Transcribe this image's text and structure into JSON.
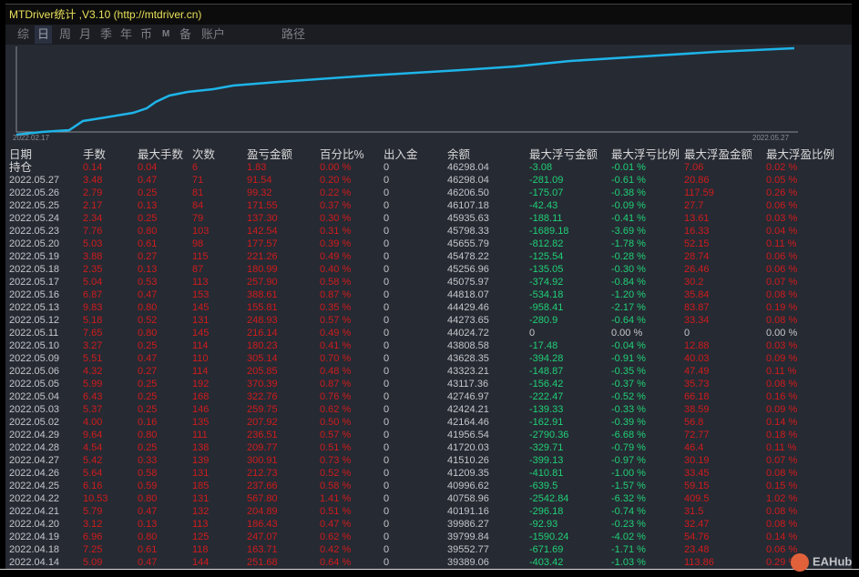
{
  "window": {
    "title": "MTDriver统计 ,V3.10 (http://mtdriver.cn)"
  },
  "toolbar": {
    "items": [
      "综",
      "日",
      "周",
      "月",
      "季",
      "年",
      "币",
      "M",
      "备",
      "账户",
      "路径"
    ],
    "selected": "日"
  },
  "chart": {
    "start_label": "2022.02.17",
    "end_label": "2022.05.27",
    "line_color": "#1eb4e8"
  },
  "table": {
    "headers": [
      "日期",
      "手数",
      "最大手数",
      "次数",
      "盈亏金额",
      "百分比%",
      "出入金",
      "余额",
      "最大浮亏金额",
      "最大浮亏比例",
      "最大浮盈金额",
      "最大浮盈比例"
    ],
    "rows": [
      [
        "持仓",
        "0.14",
        "0.04",
        "6",
        "1.83",
        "0.00 %",
        "0",
        "46298.04",
        "-3.08",
        "-0.01 %",
        "7.06",
        "0.02 %"
      ],
      [
        "2022.05.27",
        "3.48",
        "0.47",
        "71",
        "91.54",
        "0.20 %",
        "0",
        "46298.04",
        "-281.09",
        "-0.61 %",
        "20.86",
        "0.05 %"
      ],
      [
        "2022.05.26",
        "2.79",
        "0.25",
        "81",
        "99.32",
        "0.22 %",
        "0",
        "46206.50",
        "-175.07",
        "-0.38 %",
        "117.59",
        "0.26 %"
      ],
      [
        "2022.05.25",
        "2.17",
        "0.13",
        "84",
        "171.55",
        "0.37 %",
        "0",
        "46107.18",
        "-42.43",
        "-0.09 %",
        "27.7",
        "0.06 %"
      ],
      [
        "2022.05.24",
        "2.34",
        "0.25",
        "79",
        "137.30",
        "0.30 %",
        "0",
        "45935.63",
        "-188.11",
        "-0.41 %",
        "13.61",
        "0.03 %"
      ],
      [
        "2022.05.23",
        "7.76",
        "0.80",
        "103",
        "142.54",
        "0.31 %",
        "0",
        "45798.33",
        "-1689.18",
        "-3.69 %",
        "16.33",
        "0.04 %"
      ],
      [
        "2022.05.20",
        "5.03",
        "0.61",
        "98",
        "177.57",
        "0.39 %",
        "0",
        "45655.79",
        "-812.82",
        "-1.78 %",
        "52.15",
        "0.11 %"
      ],
      [
        "2022.05.19",
        "3.88",
        "0.27",
        "115",
        "221.26",
        "0.49 %",
        "0",
        "45478.22",
        "-125.54",
        "-0.28 %",
        "28.74",
        "0.06 %"
      ],
      [
        "2022.05.18",
        "2.35",
        "0.13",
        "87",
        "180.99",
        "0.40 %",
        "0",
        "45256.96",
        "-135.05",
        "-0.30 %",
        "26.46",
        "0.06 %"
      ],
      [
        "2022.05.17",
        "5.04",
        "0.53",
        "113",
        "257.90",
        "0.58 %",
        "0",
        "45075.97",
        "-374.92",
        "-0.84 %",
        "30.2",
        "0.07 %"
      ],
      [
        "2022.05.16",
        "6.87",
        "0.47",
        "153",
        "388.61",
        "0.87 %",
        "0",
        "44818.07",
        "-534.18",
        "-1.20 %",
        "35.84",
        "0.08 %"
      ],
      [
        "2022.05.13",
        "9.83",
        "0.80",
        "145",
        "155.81",
        "0.35 %",
        "0",
        "44429.46",
        "-958.41",
        "-2.17 %",
        "83.87",
        "0.19 %"
      ],
      [
        "2022.05.12",
        "5.18",
        "0.52",
        "131",
        "248.93",
        "0.57 %",
        "0",
        "44273.65",
        "-280.9",
        "-0.64 %",
        "33.34",
        "0.08 %"
      ],
      [
        "2022.05.11",
        "7.65",
        "0.80",
        "145",
        "216.14",
        "0.49 %",
        "0",
        "44024.72",
        "0",
        "0.00 %",
        "0",
        "0.00 %"
      ],
      [
        "2022.05.10",
        "3.27",
        "0.25",
        "114",
        "180.23",
        "0.41 %",
        "0",
        "43808.58",
        "-17.48",
        "-0.04 %",
        "12.88",
        "0.03 %"
      ],
      [
        "2022.05.09",
        "5.51",
        "0.47",
        "110",
        "305.14",
        "0.70 %",
        "0",
        "43628.35",
        "-394.28",
        "-0.91 %",
        "40.03",
        "0.09 %"
      ],
      [
        "2022.05.06",
        "4.32",
        "0.27",
        "114",
        "205.85",
        "0.48 %",
        "0",
        "43323.21",
        "-148.87",
        "-0.35 %",
        "47.49",
        "0.11 %"
      ],
      [
        "2022.05.05",
        "5.99",
        "0.25",
        "192",
        "370.39",
        "0.87 %",
        "0",
        "43117.36",
        "-156.42",
        "-0.37 %",
        "35.73",
        "0.08 %"
      ],
      [
        "2022.05.04",
        "6.43",
        "0.25",
        "168",
        "322.76",
        "0.76 %",
        "0",
        "42746.97",
        "-222.47",
        "-0.52 %",
        "66.18",
        "0.16 %"
      ],
      [
        "2022.05.03",
        "5.37",
        "0.25",
        "146",
        "259.75",
        "0.62 %",
        "0",
        "42424.21",
        "-139.33",
        "-0.33 %",
        "38.59",
        "0.09 %"
      ],
      [
        "2022.05.02",
        "4.00",
        "0.16",
        "135",
        "207.92",
        "0.50 %",
        "0",
        "42164.46",
        "-162.91",
        "-0.39 %",
        "56.8",
        "0.14 %"
      ],
      [
        "2022.04.29",
        "9.64",
        "0.80",
        "111",
        "236.51",
        "0.57 %",
        "0",
        "41956.54",
        "-2790.36",
        "-6.68 %",
        "72.77",
        "0.18 %"
      ],
      [
        "2022.04.28",
        "4.54",
        "0.25",
        "138",
        "209.77",
        "0.51 %",
        "0",
        "41720.03",
        "-329.71",
        "-0.79 %",
        "46.4",
        "0.11 %"
      ],
      [
        "2022.04.27",
        "5.42",
        "0.33",
        "139",
        "300.91",
        "0.73 %",
        "0",
        "41510.26",
        "-399.13",
        "-0.97 %",
        "30.19",
        "0.07 %"
      ],
      [
        "2022.04.26",
        "5.64",
        "0.58",
        "131",
        "212.73",
        "0.52 %",
        "0",
        "41209.35",
        "-410.81",
        "-1.00 %",
        "33.45",
        "0.08 %"
      ],
      [
        "2022.04.25",
        "6.16",
        "0.59",
        "185",
        "237.66",
        "0.58 %",
        "0",
        "40996.62",
        "-639.5",
        "-1.57 %",
        "59.15",
        "0.15 %"
      ],
      [
        "2022.04.22",
        "10.53",
        "0.80",
        "131",
        "567.80",
        "1.41 %",
        "0",
        "40758.96",
        "-2542.84",
        "-6.32 %",
        "409.5",
        "1.02 %"
      ],
      [
        "2022.04.21",
        "5.79",
        "0.47",
        "132",
        "204.89",
        "0.51 %",
        "0",
        "40191.16",
        "-296.18",
        "-0.74 %",
        "31.5",
        "0.08 %"
      ],
      [
        "2022.04.20",
        "3.12",
        "0.13",
        "113",
        "186.43",
        "0.47 %",
        "0",
        "39986.27",
        "-92.93",
        "-0.23 %",
        "32.47",
        "0.08 %"
      ],
      [
        "2022.04.19",
        "6.96",
        "0.80",
        "125",
        "247.07",
        "0.62 %",
        "0",
        "39799.84",
        "-1590.24",
        "-4.02 %",
        "54.76",
        "0.14 %"
      ],
      [
        "2022.04.18",
        "7.25",
        "0.61",
        "118",
        "163.71",
        "0.42 %",
        "0",
        "39552.77",
        "-671.69",
        "-1.71 %",
        "23.48",
        "0.06 %"
      ],
      [
        "2022.04.14",
        "5.09",
        "0.47",
        "144",
        "251.68",
        "0.64 %",
        "0",
        "39389.06",
        "-403.42",
        "-1.03 %",
        "113.86",
        "0.29 %"
      ]
    ]
  },
  "watermark": "EAHub",
  "colors": {
    "positive": "#d01c1c",
    "negative": "#20d076",
    "neutral": "#c4c6ca",
    "title": "#e8e05a"
  }
}
